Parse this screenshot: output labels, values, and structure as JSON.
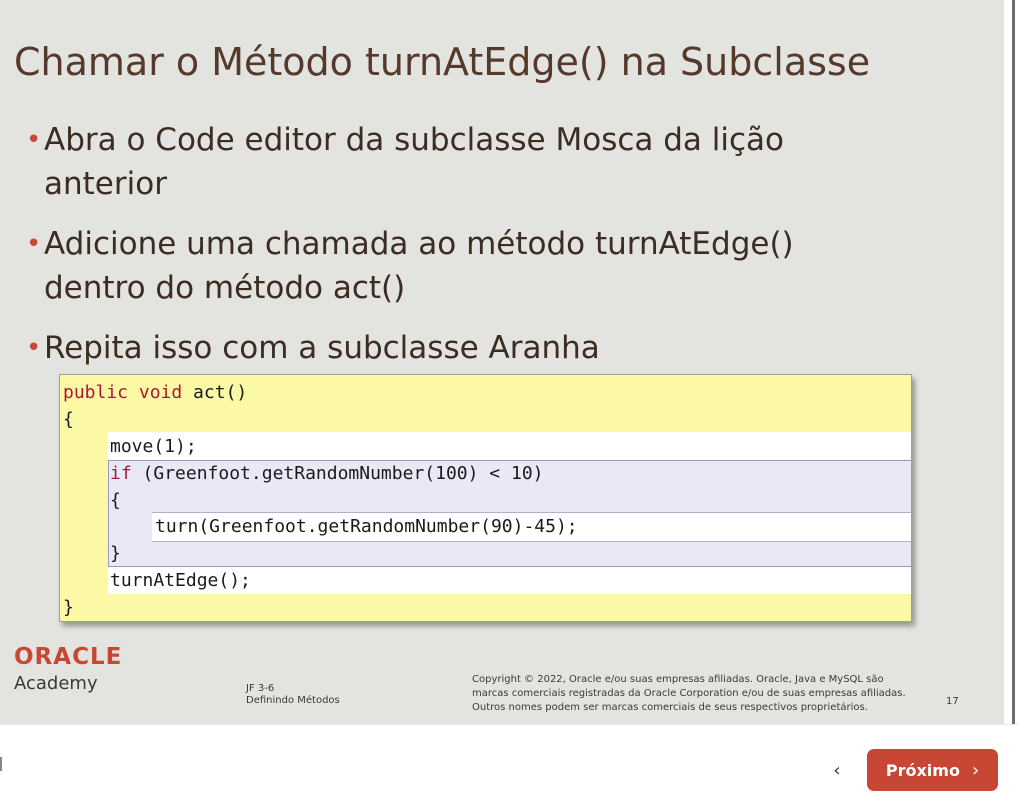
{
  "slide": {
    "title": "Chamar o Método turnAtEdge() na Subclasse",
    "bullet_marker": "•",
    "bullets": [
      "Abra o Code editor da subclasse Mosca da lição anterior",
      "Adicione uma chamada ao método turnAtEdge() dentro do método act()",
      "Repita isso com a subclasse Aranha"
    ],
    "code": {
      "line1_keyword": "public void",
      "line1_rest": " act()",
      "open_brace": "{",
      "move": "move(1);",
      "if_keyword": "if",
      "if_rest": " (Greenfoot.getRandomNumber(100) < 10)",
      "if_open": "{",
      "turn": "turn(Greenfoot.getRandomNumber(90)-45);",
      "if_close": "}",
      "turn_at_edge": "turnAtEdge();",
      "close_brace": "}"
    }
  },
  "footer": {
    "logo_text": "ORACLE",
    "academy": "Academy",
    "course_code": "JF 3-6",
    "course_title": "Definindo Métodos",
    "copyright": "Copyright © 2022, Oracle e/ou suas empresas afiliadas. Oracle, Java e MySQL são marcas comerciais registradas da Oracle Corporation e/ou de suas empresas afiliadas. Outros nomes podem ser marcas comerciais de seus respectivos proprietários.",
    "page_number": "17"
  },
  "navigation": {
    "prev_icon": "chevron-left-icon",
    "prev_glyph": "‹",
    "next_label": "Próximo",
    "next_icon": "chevron-right-icon",
    "next_glyph": "›",
    "next_color": "#c74634"
  },
  "colors": {
    "slide_background": "#e3e3df",
    "title_color": "#553a2c",
    "bullet_color": "#c74634",
    "code_background": "#fbf9a6",
    "keyword_color": "#b0172e",
    "oracle_red": "#c74634"
  }
}
